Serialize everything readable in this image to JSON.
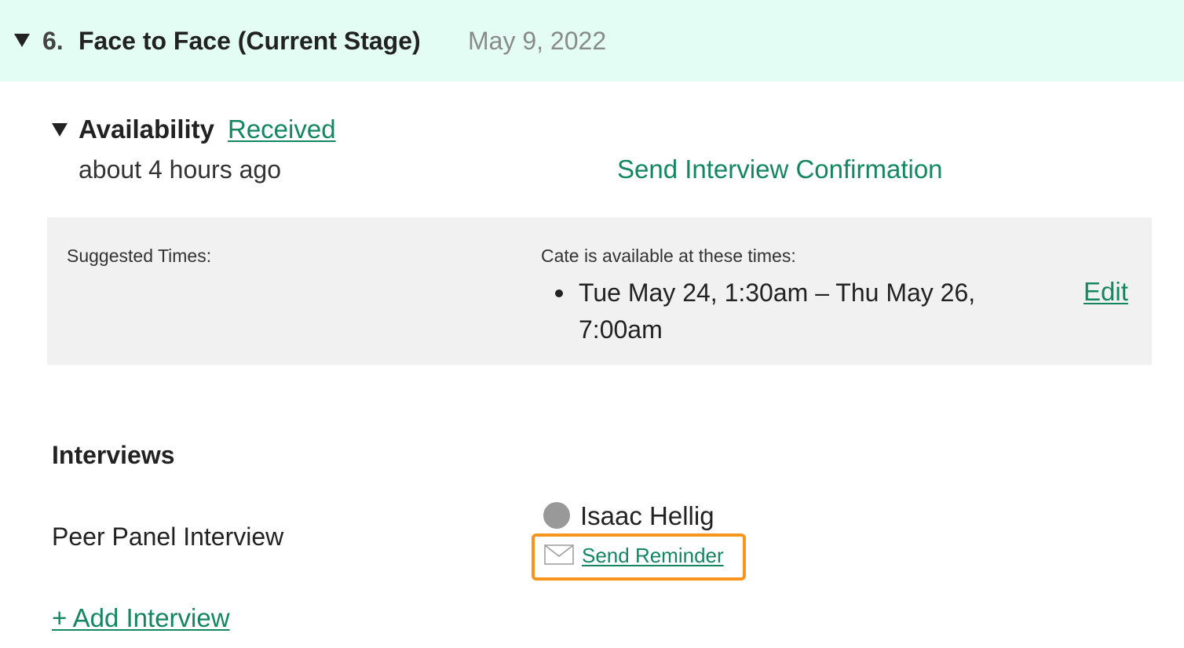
{
  "stage": {
    "number": "6.",
    "title": "Face to Face (Current Stage)",
    "date": "May 9, 2022",
    "background_color": "#e3fdf5"
  },
  "availability": {
    "title": "Availability",
    "status_link": "Received",
    "time_ago": "about 4 hours ago",
    "confirm_link": "Send Interview Confirmation"
  },
  "suggested_times": {
    "label": "Suggested Times:",
    "candidate_label": "Cate is available at these times:",
    "times": [
      "Tue May 24, 1:30am – Thu May 26, 7:00am"
    ],
    "edit_link": "Edit"
  },
  "interviews": {
    "heading": "Interviews",
    "items": [
      {
        "name": "Peer Panel Interview",
        "interviewer": "Isaac Hellig",
        "reminder_label": "Send Reminder",
        "reminder_icon": "envelope-icon"
      }
    ],
    "add_link": "+ Add Interview"
  },
  "colors": {
    "link_green": "#148660",
    "highlight_orange": "#f7941e",
    "panel_gray": "#f1f1f1"
  }
}
